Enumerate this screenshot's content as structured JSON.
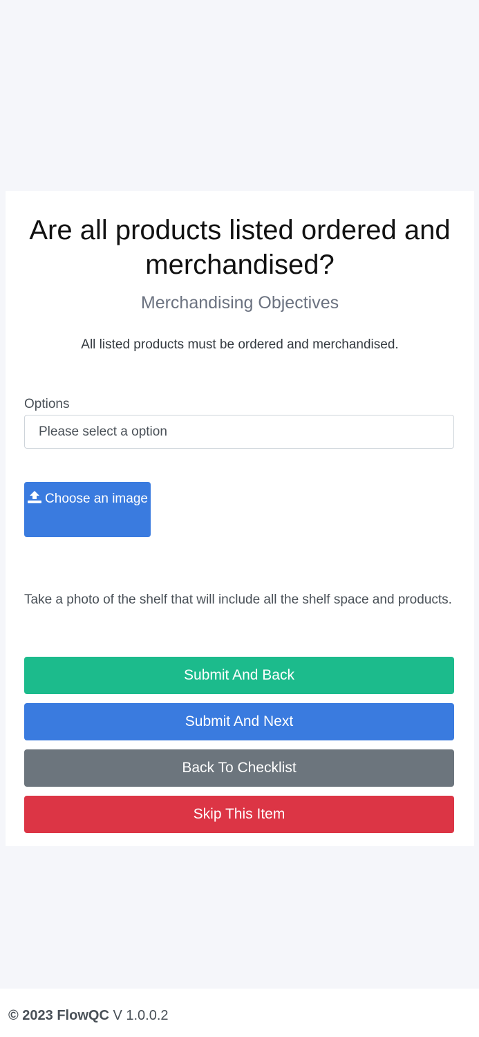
{
  "question": {
    "title": "Are all products listed ordered and merchandised?",
    "category": "Merchandising Objectives",
    "description": "All listed products must be ordered and merchandised."
  },
  "options": {
    "label": "Options",
    "selected": "Please select a option"
  },
  "upload": {
    "icon": "upload-icon",
    "label": "Choose an image"
  },
  "photo_hint": "Take a photo of the shelf that will include all the shelf space and products.",
  "actions": [
    {
      "label": "Submit And Back",
      "color": "#1cbb8c"
    },
    {
      "label": "Submit And Next",
      "color": "#3a7bdf"
    },
    {
      "label": "Back To Checklist",
      "color": "#6c757d"
    },
    {
      "label": "Skip This Item",
      "color": "#dc3545"
    }
  ],
  "footer": {
    "copyright": "© 2023 FlowQC",
    "version": "V 1.0.0.2"
  }
}
